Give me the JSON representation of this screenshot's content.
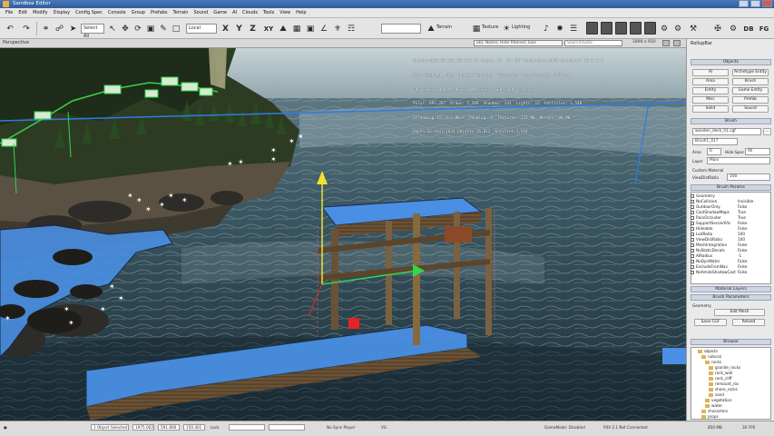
{
  "window": {
    "title": "Sandbox Editor"
  },
  "menu": [
    "File",
    "Edit",
    "Modify",
    "Display",
    "Config Spec",
    "Console",
    "Group",
    "Prefabs",
    "Terrain",
    "Sound",
    "Game",
    "AI",
    "Clouds",
    "Tools",
    "View",
    "Help"
  ],
  "toolbar": {
    "select_field": "Select All",
    "axis_x": "X",
    "axis_y": "Y",
    "axis_z": "Z",
    "axis_xy": "XY",
    "local_field": "Local",
    "terrain": "Terrain",
    "texture": "Texture",
    "lighting": "Lighting"
  },
  "viewport": {
    "label": "Perspective",
    "filter_text": "obj: Name; Hide filtered; Size",
    "search_placeholder": "Search/Goto",
    "resolution": "1890 x 910",
    "info_lines": [
      "CamPos=1935.98 591.89 150.79 Angle:-16  X:-114 ShadowSize:1049 CamsRes:X 18 0 1.6",
      "Hdr: Enabled  Res: Shadow:+Enabled  Vsync:Off  Vis:Frustum  Q:Ultra",
      "FPS: 30.5  Budget:96 FrameMs:33.5  GPU:24.9  CPU:22.1",
      "Polys: 895,287  Draws: 1,209  Shadows: 341  Lights: 12  Particles: 1,540",
      "Streaming IO: 0.5 MB/s  Pending: 0  Textures: 231 MB  Meshes: 88 MB",
      "depth:16 Pool:1024 Objects:16,812  Entities:2,914"
    ]
  },
  "rollup": {
    "title": "RollupBar",
    "objects_header": "Objects",
    "object_buttons": [
      "AI",
      "Archetype Entity",
      "Area",
      "Brush",
      "Entity",
      "Game Entity",
      "Misc",
      "Prefab",
      "Solid",
      "Sound"
    ],
    "brush_header": "Brush",
    "brush_file": "wooden_deck_01.cgf",
    "brush_name": "Brush1_417",
    "area_label": "Area",
    "area_value": "0",
    "hide_spec_label": "Hide Spec",
    "hide_spec_value": "All",
    "layer_label": "Layer",
    "layer_value": "Main",
    "custom_material_label": "Custom Material",
    "viewdist_label": "ViewDistRatio",
    "viewdist_value": "100",
    "brush_params_header": "Brush Params",
    "params": [
      {
        "label": "Geometry",
        "value": ""
      },
      {
        "label": "NoCollision",
        "value": "Invisible"
      },
      {
        "label": "OutdoorOnly",
        "value": "False"
      },
      {
        "label": "CastShadowMaps",
        "value": "True"
      },
      {
        "label": "RainOccluder",
        "value": "True"
      },
      {
        "label": "SupportSecondVis",
        "value": "False"
      },
      {
        "label": "Hideable",
        "value": "False"
      },
      {
        "label": "LodRatio",
        "value": "100"
      },
      {
        "label": "ViewDistRatio",
        "value": "100"
      },
      {
        "label": "MeshIntegration",
        "value": "False"
      },
      {
        "label": "NoStaticDecals",
        "value": "False"
      },
      {
        "label": "AIRadius",
        "value": "-1"
      },
      {
        "label": "NoDynWater",
        "value": "False"
      },
      {
        "label": "ExcludeFromNav",
        "value": "False"
      },
      {
        "label": "NoAmnbShadowCast",
        "value": "False"
      }
    ],
    "material_layers_header": "Material Layers",
    "brush_parameters_header": "Brush Parameters",
    "geometry_label": "Geometry",
    "edit_button": "Edit Mesh",
    "save_cgf": "Save CGF",
    "reload": "Reload",
    "browse_header": "Browse",
    "tree": [
      "objects",
      "natural",
      "rocks",
      "granite_rocks",
      "rock_wall",
      "rock_cliff",
      "remount_roc",
      "shore_rocks",
      "sand",
      "vegetation",
      "water",
      "characters",
      "props",
      "plax"
    ]
  },
  "status": {
    "selection": "1 Object Selected",
    "coords": [
      "1975.002",
      "591.806",
      "150.401"
    ],
    "lock": "Lock",
    "snap": "No Sync Player",
    "sound": "VG",
    "footer_left": "GameMode: Disabled",
    "footer_mid": "P4V 2.1 Not Connected",
    "footer_mem": "850 MB",
    "footer_fps": "30 FPS"
  },
  "colors": {
    "water_highlight": "#4a8fe3",
    "selection_blue": "#2e7de2",
    "gizmo_yellow": "#f2e12e",
    "gizmo_green": "#35d44a",
    "gizmo_red": "#e32424"
  }
}
